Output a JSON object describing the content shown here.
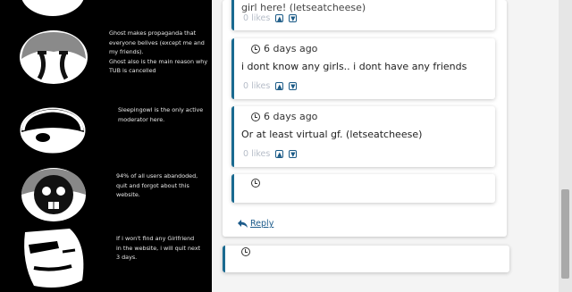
{
  "left_panel": {
    "captions": [
      [
        "Ghost makes propaganda that",
        "everyone belives (except me and",
        "my friends).",
        "Ghost also is the main reason why",
        "TUB is cancelled"
      ],
      [
        "Sleepingowl is the only active",
        "moderator here."
      ],
      [
        "94% of all users abandoded,",
        "quit and forgot about this",
        "website."
      ],
      [
        "If i won't find any Girlfriend",
        "in the website, i will quit next",
        "3 days."
      ]
    ]
  },
  "comments": [
    {
      "time": "",
      "text": "girl here! (letseatcheese)",
      "likes": "0 likes"
    },
    {
      "time": "6 days ago",
      "text": "i dont know any girls.. i dont have any friends",
      "likes": "0 likes"
    },
    {
      "time": "6 days ago",
      "text": "Or at least virtual gf. (letseatcheese)",
      "likes": "0 likes"
    },
    {
      "time": "",
      "text": "",
      "likes": ""
    }
  ],
  "reply_label": "Reply",
  "bottom_card": {
    "time": ""
  },
  "icons": {
    "clock": "clock-icon",
    "like": "thumbs-up-icon",
    "dislike": "thumbs-down-icon",
    "reply": "reply-arrow-icon"
  },
  "colors": {
    "accent": "#1a6a90",
    "likes_text": "#b6bdc8",
    "link": "#1b5a8a"
  }
}
